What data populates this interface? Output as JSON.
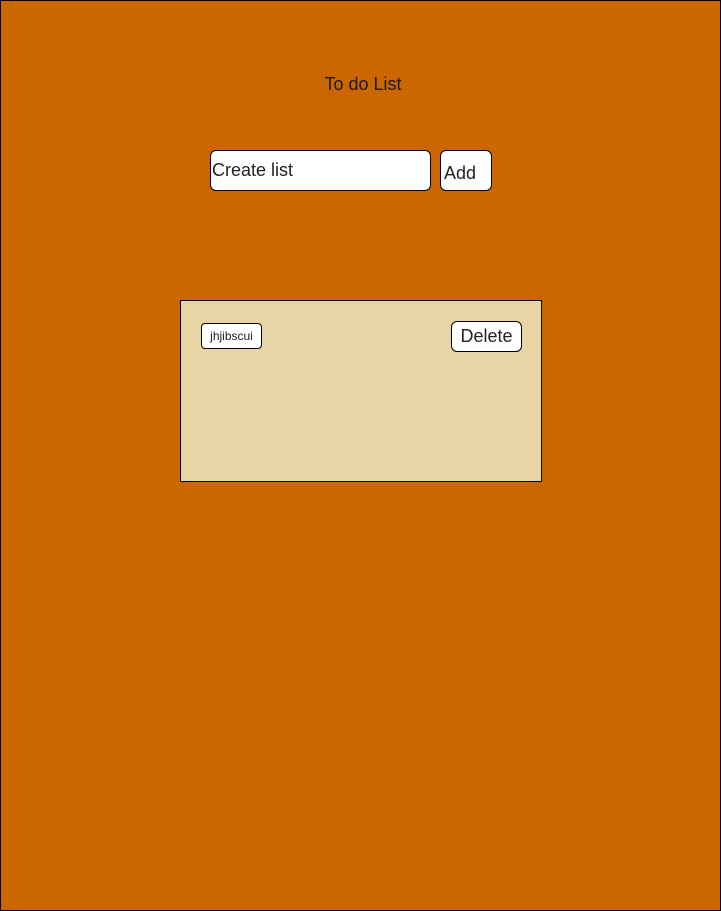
{
  "app": {
    "title": "To do List",
    "background_color": "#cc6600"
  },
  "create_form": {
    "input_placeholder": "Create list",
    "input_value": "",
    "add_label": "Add"
  },
  "list": {
    "background_color": "#e8d4a4",
    "items": [
      {
        "text": "jhjibscui",
        "delete_label": "Delete"
      }
    ]
  }
}
